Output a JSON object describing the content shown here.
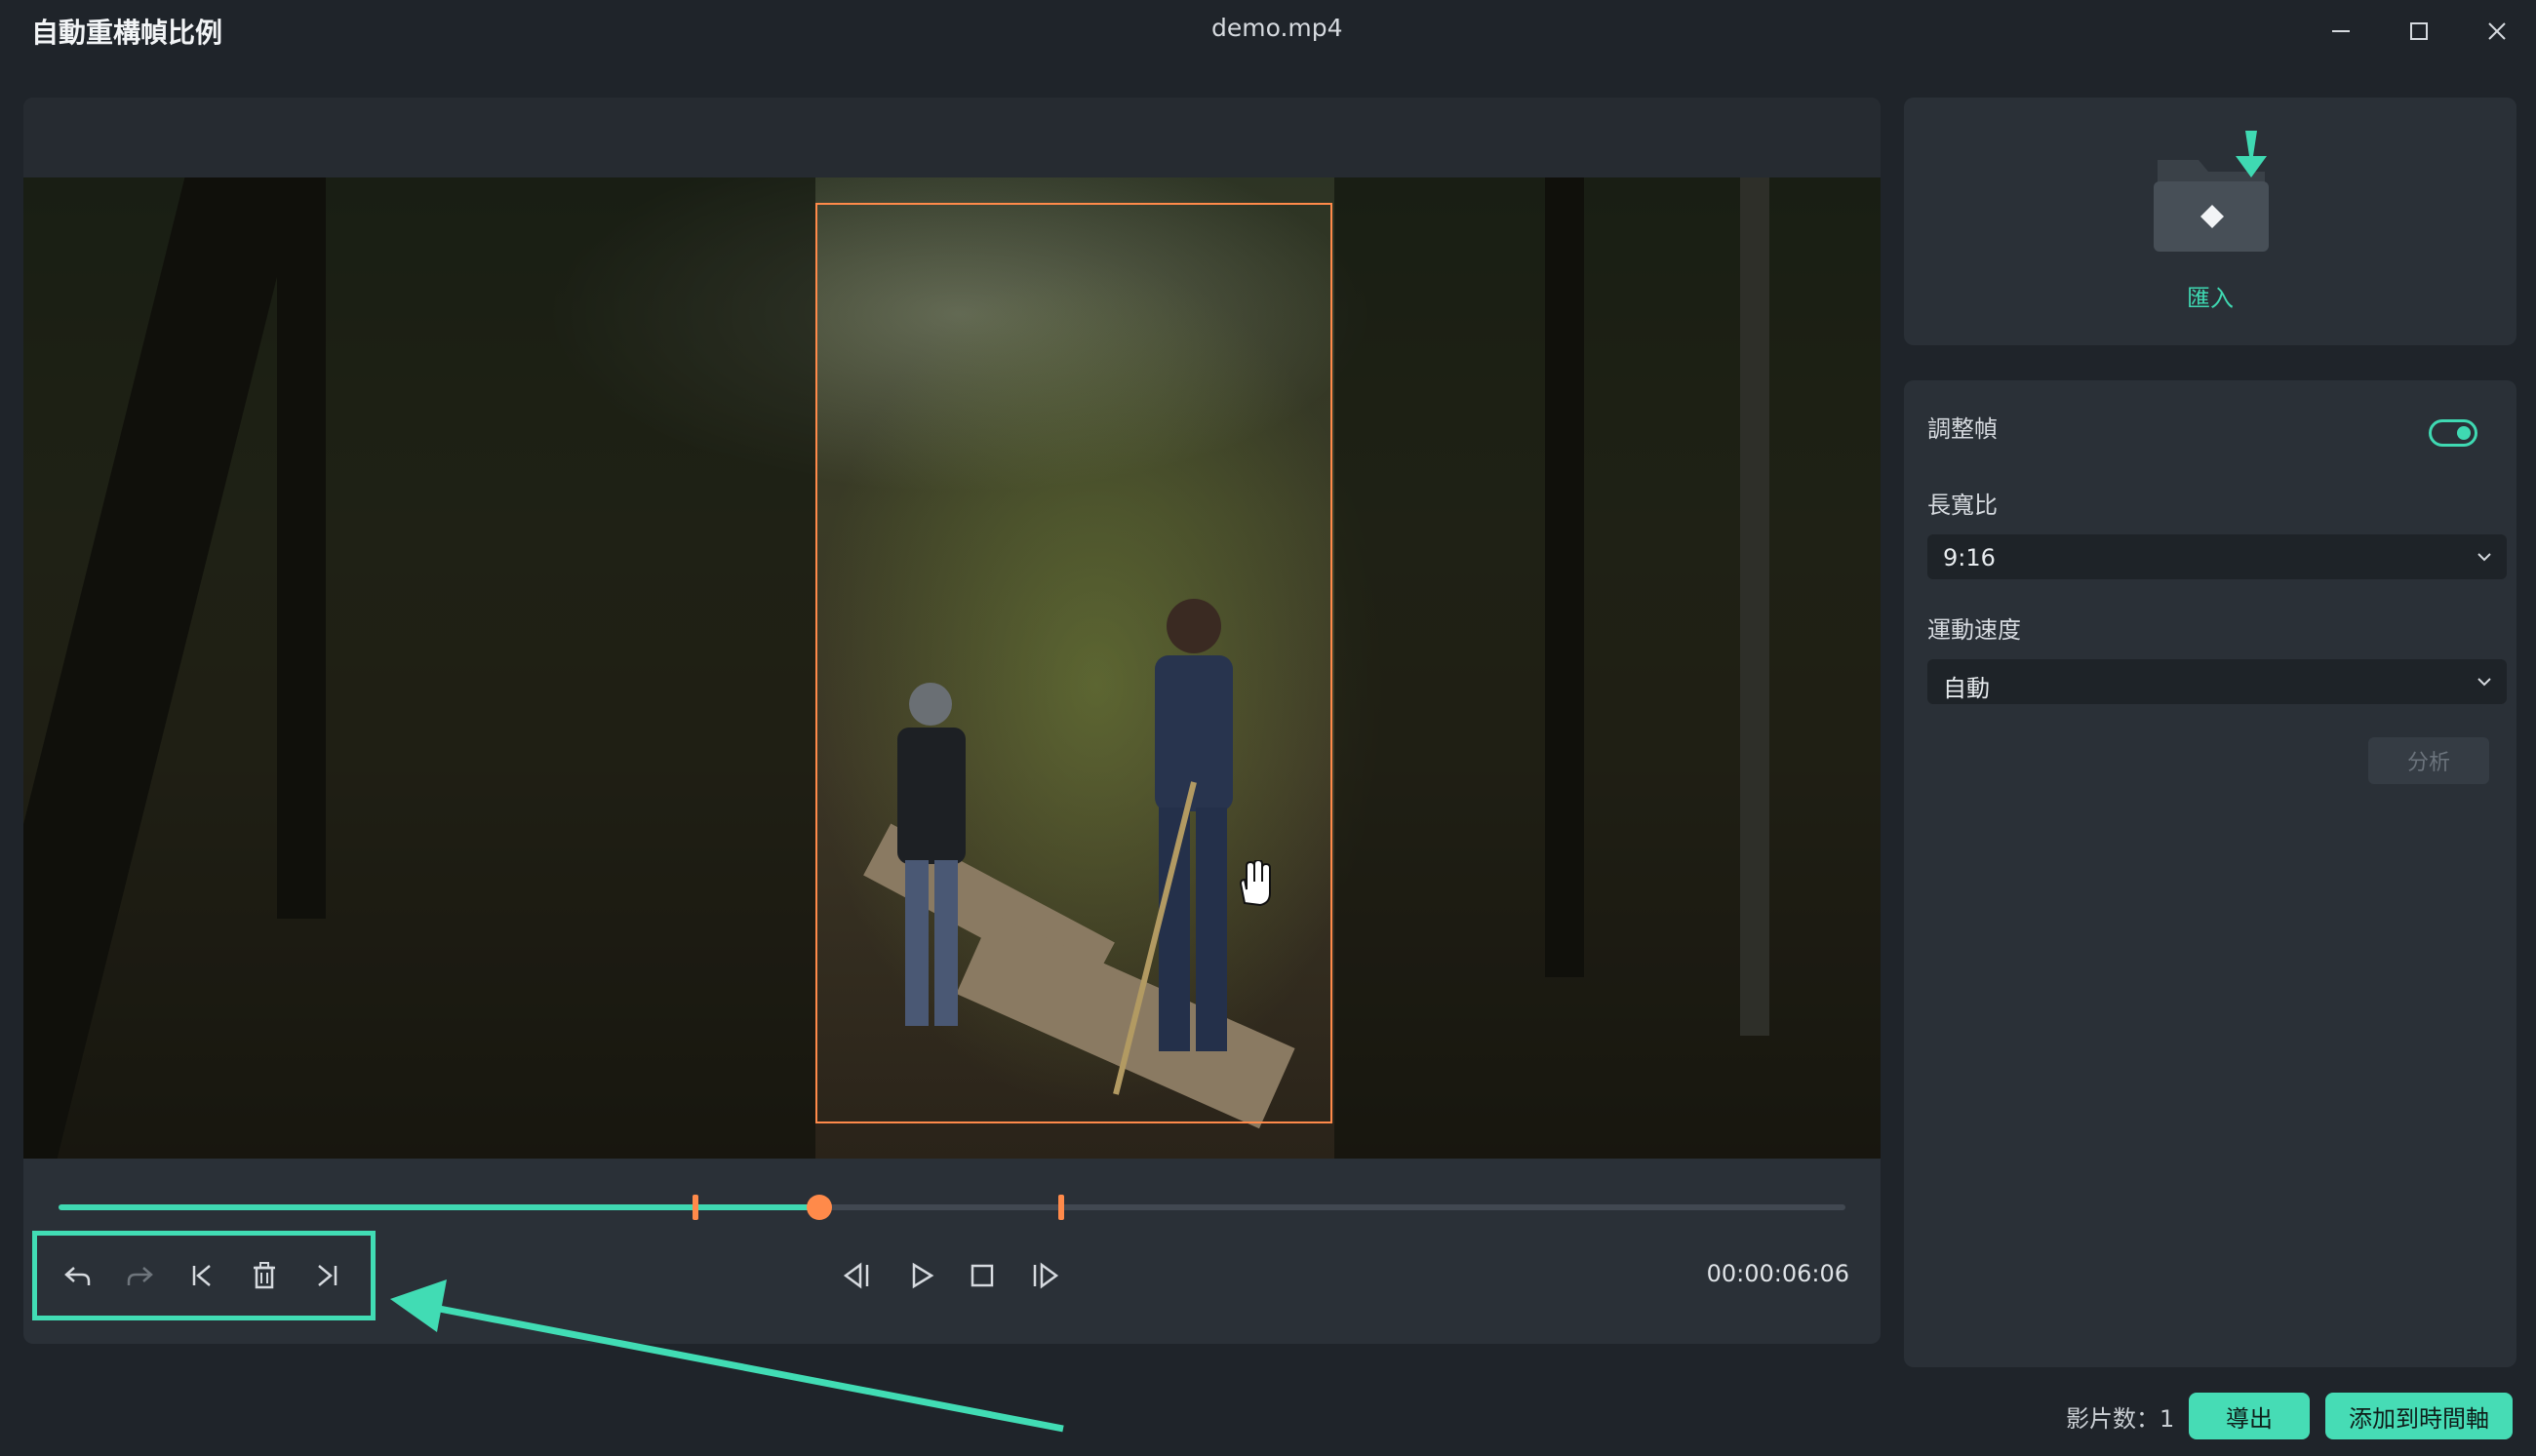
{
  "window": {
    "app_title": "自動重構幀比例",
    "file_name": "demo.mp4"
  },
  "preview": {
    "timecode": "00:00:06:06",
    "progress": 0.42
  },
  "import_card": {
    "label": "匯入"
  },
  "settings": {
    "adjust_frame_label": "調整幀",
    "adjust_frame_enabled": true,
    "aspect_ratio_label": "長寬比",
    "aspect_ratio_value": "9:16",
    "motion_speed_label": "運動速度",
    "motion_speed_value": "自動",
    "analyze_label": "分析"
  },
  "footer": {
    "clip_count": "影片数：1",
    "export_label": "導出",
    "add_to_timeline_label": "添加到時間軸"
  },
  "colors": {
    "accent": "#3fd9b2",
    "keyframe": "#ff8a4a",
    "highlight_box": "#41dcb4"
  }
}
